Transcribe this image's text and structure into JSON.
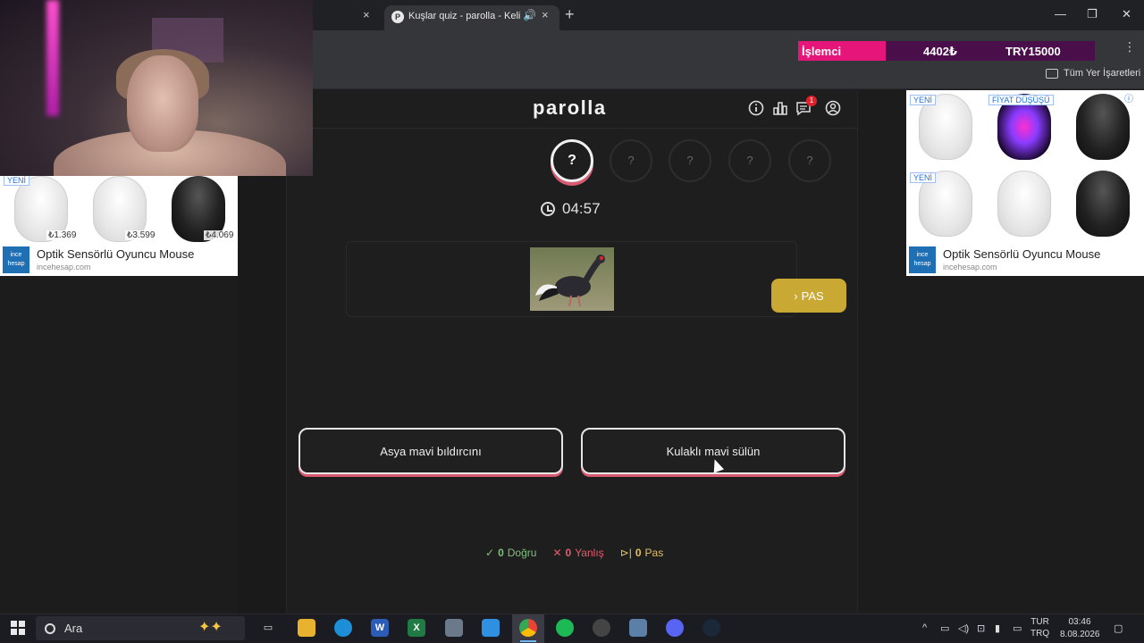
{
  "browser": {
    "prev_tab_close": "×",
    "active_tab": {
      "title": "Kuşlar quiz - parolla - Kelim",
      "favicon": "P",
      "speaker": "🔊",
      "close": "×"
    },
    "new_tab": "+",
    "window_controls": {
      "minimize": "—",
      "maximize": "❐",
      "close": "✕"
    },
    "menu": "⋮",
    "bookmarks_folder": "Tüm Yer İşaretleri"
  },
  "top_ad": {
    "label": "İşlemci",
    "price": "4402₺",
    "promo": "TRY15000"
  },
  "game": {
    "logo": "parolla",
    "notification_count": "1",
    "rounds": [
      "?",
      "?",
      "?",
      "?",
      "?"
    ],
    "timer": "04:57",
    "pass_button": "PAS",
    "answers": [
      "Asya mavi bıldırcını",
      "Kulaklı mavi sülün"
    ],
    "stats": {
      "correct": {
        "count": "0",
        "label": "Doğru",
        "color": "#7fbf7f"
      },
      "wrong": {
        "count": "0",
        "label": "Yanlış",
        "color": "#e25c6e"
      },
      "pass": {
        "count": "0",
        "label": "Pas",
        "color": "#e0c060"
      }
    }
  },
  "ad_left": {
    "tag": "YENİ",
    "prices": [
      "₺1.369",
      "₺3.599",
      "₺4.069"
    ],
    "logo": "ince hesap",
    "title": "Optik Sensörlü Oyuncu Mouse",
    "domain": "incehesap.com"
  },
  "ad_right": {
    "tags": [
      "YENİ",
      "FİYAT DÜŞÜŞÜ",
      "YENİ"
    ],
    "logo": "ince hesap",
    "title": "Optik Sensörlü Oyuncu Mouse",
    "domain": "incehesap.com"
  },
  "taskbar": {
    "search_placeholder": "Ara",
    "lang_top": "TUR",
    "lang_bottom": "TRQ",
    "time": "03:46",
    "date": "8.08.2026"
  },
  "colors": {
    "accent_pink": "#d85a70",
    "pass_gold": "#c9a834",
    "background": "#1e1e1e"
  }
}
